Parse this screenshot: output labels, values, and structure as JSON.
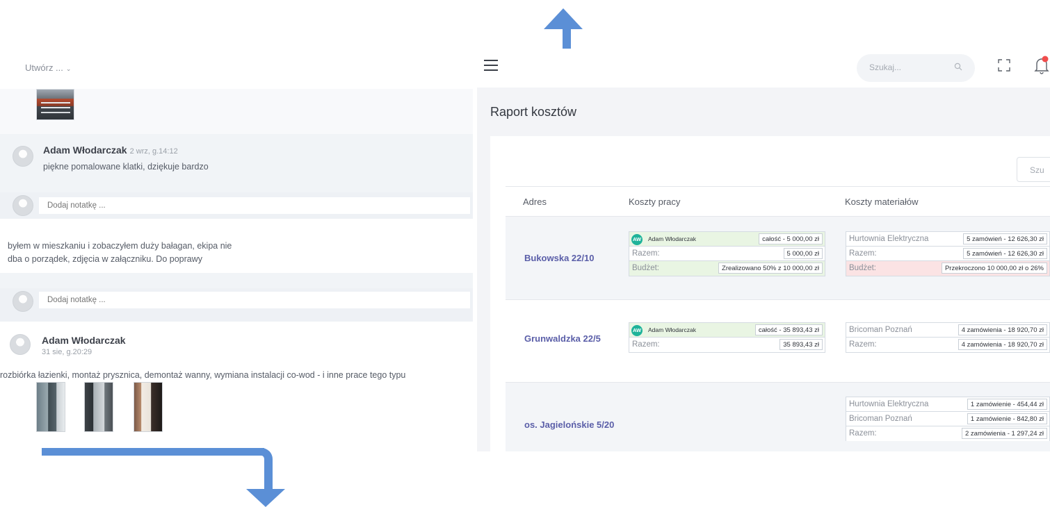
{
  "left_panel": {
    "create_menu": {
      "label": "Utwórz ...",
      "chevron": "⌄"
    },
    "comment1": {
      "author": "Adam Włodarczak",
      "time": "2 wrz, g.14:12",
      "text": "piękne pomalowane klatki, dziękuje bardzo"
    },
    "note_placeholder": "Dodaj notatkę ...",
    "standalone_comment": {
      "line1": "byłem w mieszkaniu i zobaczyłem duży bałagan, ekipa nie",
      "line2": "dba o porządek, zdjęcia w załączniku. Do poprawy"
    },
    "note_placeholder2": "Dodaj notatkę ...",
    "comment2": {
      "author": "Adam Włodarczak",
      "time": "31 sie, g.20:29",
      "text": "rozbiórka łazienki, montaż prysznica, demontaż wanny, wymiana instalacji co-wod - i inne prace tego typu"
    }
  },
  "right_panel": {
    "search_placeholder": "Szukaj...",
    "page_title": "Raport kosztów",
    "table_search_placeholder": "Szu",
    "headers": {
      "address": "Adres",
      "labor": "Koszty pracy",
      "materials": "Koszty materiałów"
    },
    "rows": [
      {
        "address": "Bukowska 22/10",
        "labor": {
          "worker_initials": "AW",
          "worker_name": "Adam Włodarczak",
          "worker_value": "całość - 5 000,00 zł",
          "total_label": "Razem:",
          "total_value": "5 000,00 zł",
          "budget_label": "Budżet:",
          "budget_value": "Zrealizowano 50% z 10 000,00 zł"
        },
        "materials": {
          "supplier": "Hurtownia Elektryczna",
          "supplier_value": "5 zamówień - 12 626,30 zł",
          "total_label": "Razem:",
          "total_value": "5 zamówień - 12 626,30 zł",
          "budget_label": "Budżet:",
          "budget_value": "Przekroczono 10 000,00 zł o 26%"
        }
      },
      {
        "address": "Grunwaldzka 22/5",
        "labor": {
          "worker_initials": "AW",
          "worker_name": "Adam Włodarczak",
          "worker_value": "całość - 35 893,43 zł",
          "total_label": "Razem:",
          "total_value": "35 893,43 zł"
        },
        "materials": {
          "supplier": "Bricoman Poznań",
          "supplier_value": "4 zamówienia - 18 920,70 zł",
          "total_label": "Razem:",
          "total_value": "4 zamówienia - 18 920,70 zł"
        }
      },
      {
        "address": "os. Jagielońskie 5/20",
        "materials": {
          "supplier1": "Hurtownia Elektryczna",
          "supplier1_value": "1 zamówienie - 454,44 zł",
          "supplier2": "Bricoman Poznań",
          "supplier2_value": "1 zamówienie - 842,80 zł",
          "total_label": "Razem:",
          "total_value": "2 zamówienia - 1 297,24 zł"
        }
      }
    ]
  },
  "colors": {
    "arrow": "#5b8fd6",
    "address_link": "#5a5ea8",
    "avatar_badge": "#1fb39a",
    "budget_ok": "#e9f5e3",
    "budget_over": "#fbe3e4"
  },
  "icons": [
    "hamburger-icon",
    "search-icon",
    "fullscreen-icon",
    "bell-icon",
    "chevron-down-icon",
    "avatar-placeholder-icon",
    "up-arrow",
    "down-arrow"
  ]
}
